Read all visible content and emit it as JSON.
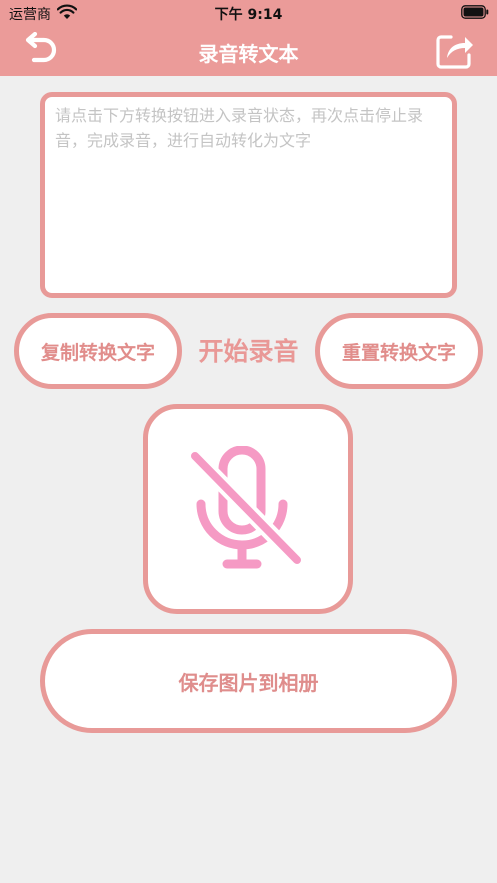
{
  "status_bar": {
    "carrier": "运营商",
    "time": "下午 9:14"
  },
  "nav": {
    "title": "录音转文本",
    "back_icon": "back-arrow-icon",
    "share_icon": "share-icon"
  },
  "text_area": {
    "placeholder": "请点击下方转换按钮进入录音状态，再次点击停止录音，完成录音，进行自动转化为文字",
    "value": ""
  },
  "actions": {
    "copy_label": "复制转换文字",
    "record_status": "开始录音",
    "reset_label": "重置转换文字",
    "save_label": "保存图片到相册"
  },
  "mic": {
    "icon": "microphone-off-icon",
    "color": "#f59ac4"
  },
  "colors": {
    "accent": "#eb9b99",
    "border": "#e89a98",
    "background": "#efefef"
  }
}
